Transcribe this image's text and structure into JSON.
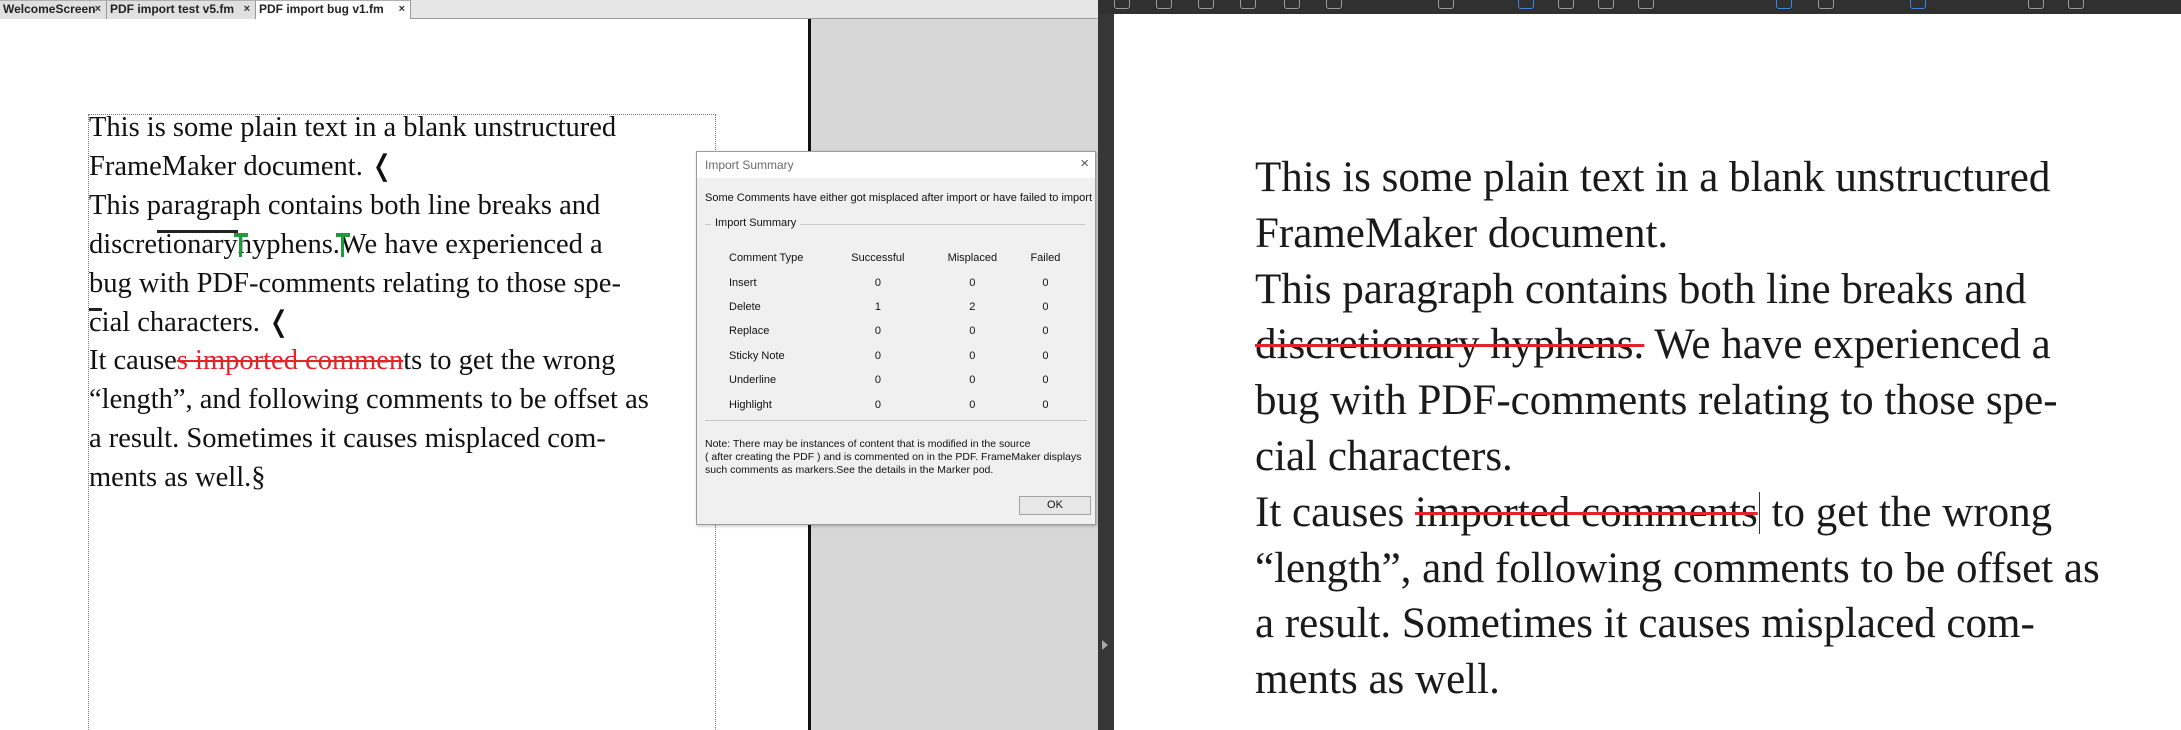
{
  "tabs": [
    {
      "label": "WelcomeScreen",
      "close": "×"
    },
    {
      "label": "PDF import test v5.fm",
      "close": "×"
    },
    {
      "label": "PDF import bug v1.fm",
      "close": "×"
    }
  ],
  "fm_doc": {
    "l1": "This is some plain text in a blank unstructured",
    "l2": "FrameMaker document.",
    "l2_sym": "❬",
    "l3": "This paragraph contains both line breaks and",
    "l4a": "discre",
    "l4b": "tionary",
    "l4c": "hyphens.",
    "l4d": "We have experienced a",
    "l5": "bug with PDF-comments relating to those spe-",
    "l6a": "c",
    "l6b": "ial characters.",
    "l6_sym": "❬",
    "l7a": "It cause",
    "l7b": "s imported commen",
    "l7c": "ts to get the wrong",
    "l8": "“length”, and following comments to be offset as",
    "l9": "a result. Sometimes it causes misplaced com-",
    "l10": "ments as well.",
    "l10_sym": "§"
  },
  "dialog": {
    "title": "Import Summary",
    "close": "×",
    "message": "Some Comments have either got misplaced after import or have failed to import",
    "group_label": "Import Summary",
    "headers": [
      "Comment Type",
      "Successful",
      "Misplaced",
      "Failed"
    ],
    "rows": [
      {
        "type": "Insert",
        "successful": "0",
        "misplaced": "0",
        "failed": "0"
      },
      {
        "type": "Delete",
        "successful": "1",
        "misplaced": "2",
        "failed": "0"
      },
      {
        "type": "Replace",
        "successful": "0",
        "misplaced": "0",
        "failed": "0"
      },
      {
        "type": "Sticky Note",
        "successful": "0",
        "misplaced": "0",
        "failed": "0"
      },
      {
        "type": "Underline",
        "successful": "0",
        "misplaced": "0",
        "failed": "0"
      },
      {
        "type": "Highlight",
        "successful": "0",
        "misplaced": "0",
        "failed": "0"
      }
    ],
    "note_l1": "Note: There may be instances of content that is modified in the source",
    "note_l2": "( after creating the PDF ) and is commented on in the PDF. FrameMaker displays",
    "note_l3": "such comments as markers.See the details in the Marker pod.",
    "ok": "OK"
  },
  "pdf_doc": {
    "l1": "This is some plain text in a blank unstructured",
    "l2": "FrameMaker document.",
    "l3": "This paragraph contains both line breaks and",
    "l4a": "discretionary hyphens.",
    "l4b": " We have experienced a",
    "l5": "bug with PDF-comments relating to those spe-",
    "l6": "cial characters.",
    "l7a": "It causes ",
    "l7b": "imported comments",
    "l7c": " to get the wrong",
    "l8": "“length”, and following comments to be offset as",
    "l9": "a result. Sometimes it causes misplaced com-",
    "l10": "ments as well."
  },
  "colors": {
    "strike_red": "#e5232a",
    "marker_green": "#1e9b3c",
    "pdf_chrome": "#303030",
    "pasteboard": "#d7d7d7"
  },
  "icons": [
    "home-icon",
    "upload-icon",
    "print-icon",
    "zoom-icon",
    "prev-page-icon",
    "next-page-icon",
    "find-icon",
    "select-tool-icon",
    "hand-tool-icon",
    "zoom-out-icon",
    "zoom-in-icon",
    "fit-page-icon",
    "rotate-icon",
    "scroll-icon",
    "comment-icon",
    "sign-icon"
  ]
}
